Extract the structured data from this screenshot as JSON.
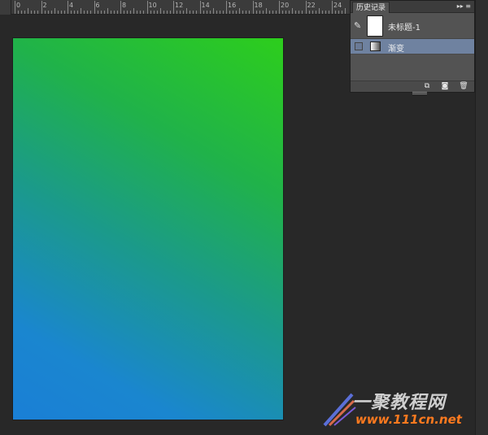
{
  "ruler": {
    "numbers": [
      "0",
      "2",
      "4",
      "6",
      "8",
      "10",
      "12",
      "14",
      "16",
      "18",
      "20",
      "22",
      "24"
    ]
  },
  "history_panel": {
    "tab_label": "历史记录",
    "collapse_icon": "double-arrow-icon",
    "menu_icon": "panel-menu-icon",
    "snapshot": {
      "label": "未标题-1",
      "icon": "history-brush-icon"
    },
    "states": [
      {
        "label": "渐变",
        "icon": "gradient-icon"
      }
    ],
    "footer_buttons": [
      {
        "name": "new-document-from-state-button",
        "icon": "new-doc-icon"
      },
      {
        "name": "create-snapshot-button",
        "icon": "camera-icon"
      },
      {
        "name": "delete-state-button",
        "icon": "trash-icon"
      }
    ]
  },
  "canvas": {
    "gradient_colors": [
      "#1a7fd6",
      "#2dce1c"
    ]
  },
  "watermark": {
    "title": "一聚教程网",
    "url": "www.111cn.net"
  }
}
